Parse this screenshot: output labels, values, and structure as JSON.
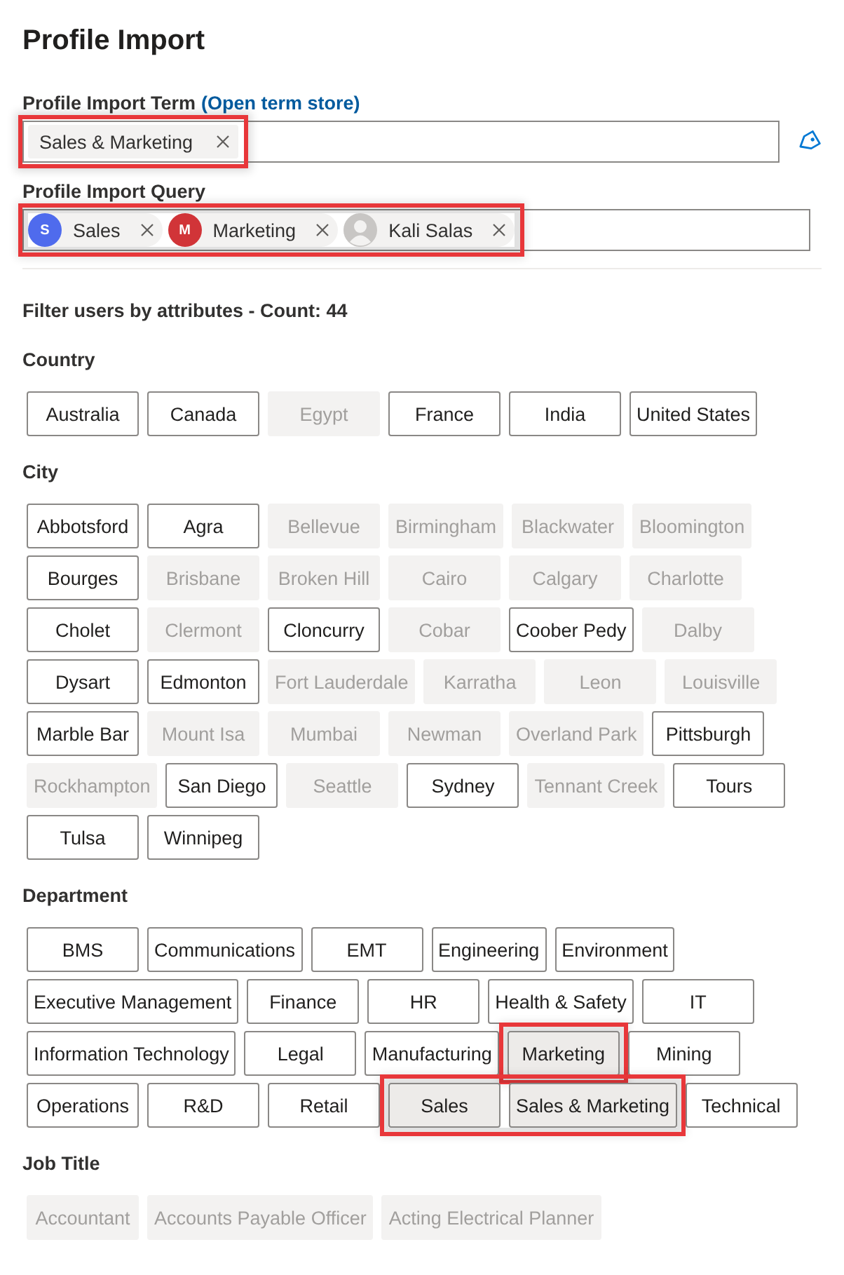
{
  "title": "Profile Import",
  "term": {
    "label": "Profile Import Term",
    "link": "(Open term store)",
    "tokens": [
      {
        "text": "Sales & Marketing",
        "highlighted": true
      }
    ]
  },
  "query": {
    "label": "Profile Import Query",
    "highlighted": true,
    "tokens": [
      {
        "text": "Sales",
        "initials": "S",
        "color": "#4f6bed",
        "kind": "initials"
      },
      {
        "text": "Marketing",
        "initials": "M",
        "color": "#d13438",
        "kind": "initials"
      },
      {
        "text": "Kali Salas",
        "kind": "person"
      }
    ]
  },
  "filter_heading": "Filter users by attributes - Count: 44",
  "sections": [
    {
      "title": "Country",
      "items": [
        {
          "text": "Australia",
          "disabled": false,
          "selected": false
        },
        {
          "text": "Canada",
          "disabled": false,
          "selected": false
        },
        {
          "text": "Egypt",
          "disabled": true,
          "selected": false
        },
        {
          "text": "France",
          "disabled": false,
          "selected": false
        },
        {
          "text": "India",
          "disabled": false,
          "selected": false
        },
        {
          "text": "United States",
          "disabled": false,
          "selected": false
        }
      ]
    },
    {
      "title": "City",
      "items": [
        {
          "text": "Abbotsford",
          "disabled": false,
          "selected": false
        },
        {
          "text": "Agra",
          "disabled": false,
          "selected": false
        },
        {
          "text": "Bellevue",
          "disabled": true,
          "selected": false
        },
        {
          "text": "Birmingham",
          "disabled": true,
          "selected": false
        },
        {
          "text": "Blackwater",
          "disabled": true,
          "selected": false
        },
        {
          "text": "Bloomington",
          "disabled": true,
          "selected": false
        },
        {
          "text": "Bourges",
          "disabled": false,
          "selected": false
        },
        {
          "text": "Brisbane",
          "disabled": true,
          "selected": false
        },
        {
          "text": "Broken Hill",
          "disabled": true,
          "selected": false
        },
        {
          "text": "Cairo",
          "disabled": true,
          "selected": false
        },
        {
          "text": "Calgary",
          "disabled": true,
          "selected": false
        },
        {
          "text": "Charlotte",
          "disabled": true,
          "selected": false
        },
        {
          "text": "Cholet",
          "disabled": false,
          "selected": false
        },
        {
          "text": "Clermont",
          "disabled": true,
          "selected": false
        },
        {
          "text": "Cloncurry",
          "disabled": false,
          "selected": false
        },
        {
          "text": "Cobar",
          "disabled": true,
          "selected": false
        },
        {
          "text": "Coober Pedy",
          "disabled": false,
          "selected": false
        },
        {
          "text": "Dalby",
          "disabled": true,
          "selected": false
        },
        {
          "text": "Dysart",
          "disabled": false,
          "selected": false
        },
        {
          "text": "Edmonton",
          "disabled": false,
          "selected": false
        },
        {
          "text": "Fort Lauderdale",
          "disabled": true,
          "selected": false
        },
        {
          "text": "Karratha",
          "disabled": true,
          "selected": false
        },
        {
          "text": "Leon",
          "disabled": true,
          "selected": false
        },
        {
          "text": "Louisville",
          "disabled": true,
          "selected": false
        },
        {
          "text": "Marble Bar",
          "disabled": false,
          "selected": false
        },
        {
          "text": "Mount Isa",
          "disabled": true,
          "selected": false
        },
        {
          "text": "Mumbai",
          "disabled": true,
          "selected": false
        },
        {
          "text": "Newman",
          "disabled": true,
          "selected": false
        },
        {
          "text": "Overland Park",
          "disabled": true,
          "selected": false
        },
        {
          "text": "Pittsburgh",
          "disabled": false,
          "selected": false
        },
        {
          "text": "Rockhampton",
          "disabled": true,
          "selected": false
        },
        {
          "text": "San Diego",
          "disabled": false,
          "selected": false
        },
        {
          "text": "Seattle",
          "disabled": true,
          "selected": false
        },
        {
          "text": "Sydney",
          "disabled": false,
          "selected": false
        },
        {
          "text": "Tennant Creek",
          "disabled": true,
          "selected": false
        },
        {
          "text": "Tours",
          "disabled": false,
          "selected": false
        },
        {
          "text": "Tulsa",
          "disabled": false,
          "selected": false
        },
        {
          "text": "Winnipeg",
          "disabled": false,
          "selected": false
        }
      ]
    },
    {
      "title": "Department",
      "items": [
        {
          "text": "BMS",
          "disabled": false,
          "selected": false
        },
        {
          "text": "Communications",
          "disabled": false,
          "selected": false
        },
        {
          "text": "EMT",
          "disabled": false,
          "selected": false
        },
        {
          "text": "Engineering",
          "disabled": false,
          "selected": false
        },
        {
          "text": "Environment",
          "disabled": false,
          "selected": false
        },
        {
          "text": "Executive Management",
          "disabled": false,
          "selected": false
        },
        {
          "text": "Finance",
          "disabled": false,
          "selected": false
        },
        {
          "text": "HR",
          "disabled": false,
          "selected": false
        },
        {
          "text": "Health & Safety",
          "disabled": false,
          "selected": false
        },
        {
          "text": "IT",
          "disabled": false,
          "selected": false
        },
        {
          "text": "Information Technology",
          "disabled": false,
          "selected": false
        },
        {
          "text": "Legal",
          "disabled": false,
          "selected": false
        },
        {
          "text": "Manufacturing",
          "disabled": false,
          "selected": false
        },
        {
          "kind": "highlight",
          "items": [
            {
              "text": "Marketing",
              "disabled": false,
              "selected": true
            }
          ]
        },
        {
          "text": "Mining",
          "disabled": false,
          "selected": false
        },
        {
          "text": "Operations",
          "disabled": false,
          "selected": false
        },
        {
          "text": "R&D",
          "disabled": false,
          "selected": false
        },
        {
          "text": "Retail",
          "disabled": false,
          "selected": false
        },
        {
          "kind": "highlight",
          "items": [
            {
              "text": "Sales",
              "disabled": false,
              "selected": true
            },
            {
              "text": "Sales & Marketing",
              "disabled": false,
              "selected": true
            }
          ]
        },
        {
          "text": "Technical",
          "disabled": false,
          "selected": false
        }
      ]
    },
    {
      "title": "Job Title",
      "items": [
        {
          "text": "Accountant",
          "disabled": true,
          "selected": false
        },
        {
          "text": "Accounts Payable Officer",
          "disabled": true,
          "selected": false
        },
        {
          "text": "Acting Electrical Planner",
          "disabled": true,
          "selected": false
        }
      ]
    }
  ]
}
